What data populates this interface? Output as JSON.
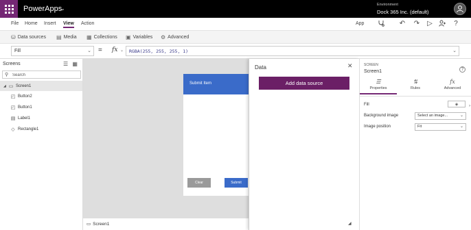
{
  "titlebar": {
    "app_name": "PowerApps",
    "env_label": "Environment",
    "env_name": "Dock 365 Inc. (default)",
    "brand_color": "#742774"
  },
  "menu": {
    "items": [
      "File",
      "Home",
      "Insert",
      "View",
      "Action"
    ],
    "active": "View",
    "app_label": "App"
  },
  "ribbon": {
    "items": [
      {
        "label": "Data sources",
        "icon": "database-icon"
      },
      {
        "label": "Media",
        "icon": "media-icon"
      },
      {
        "label": "Collections",
        "icon": "collections-icon"
      },
      {
        "label": "Variables",
        "icon": "variables-icon"
      },
      {
        "label": "Advanced",
        "icon": "advanced-icon"
      }
    ]
  },
  "formula": {
    "property": "Fill",
    "equals": "=",
    "fx": "fx",
    "expression": "RGBA(255, 255, 255, 1)"
  },
  "tree": {
    "title": "Screens",
    "search_placeholder": "Search",
    "items": [
      {
        "label": "Screen1",
        "icon": "screen-icon"
      },
      {
        "label": "Button2",
        "icon": "button-icon"
      },
      {
        "label": "Button1",
        "icon": "button-icon"
      },
      {
        "label": "Label1",
        "icon": "label-icon"
      },
      {
        "label": "Rectangle1",
        "icon": "shape-icon"
      }
    ]
  },
  "canvas": {
    "header_title": "Submit Item",
    "clear_label": "Clear",
    "submit_label": "Submit",
    "header_color": "#3a6bc9",
    "bottom_screen": "Screen1"
  },
  "data_panel": {
    "title": "Data",
    "add_button": "Add data source",
    "button_color": "#6b1f66"
  },
  "props": {
    "type": "SCREEN",
    "name": "Screen1",
    "tabs": [
      "Properties",
      "Rules",
      "Advanced"
    ],
    "active_tab": "Properties",
    "fill_label": "Fill",
    "background_image_label": "Background image",
    "background_image_value": "Select an image...",
    "image_position_label": "Image position",
    "image_position_value": "Fit"
  }
}
